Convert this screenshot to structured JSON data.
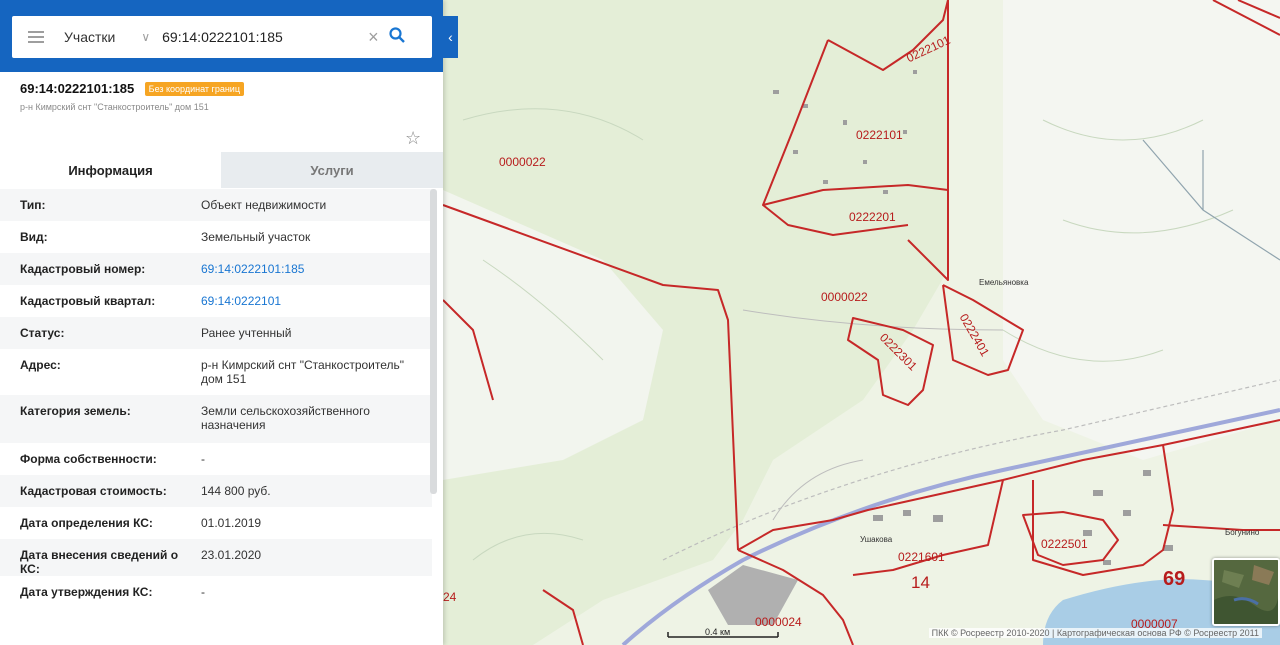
{
  "search": {
    "type_label": "Участки",
    "query": "69:14:0222101:185"
  },
  "object": {
    "number": "69:14:0222101:185",
    "badge": "Без координат границ",
    "address_short": "р-н Кимрский снт \"Станкостроитель\" дом 151"
  },
  "tabs": {
    "info": "Информация",
    "services": "Услуги"
  },
  "properties": [
    {
      "label": "Тип:",
      "value": "Объект недвижимости",
      "link": false
    },
    {
      "label": "Вид:",
      "value": "Земельный участок",
      "link": false
    },
    {
      "label": "Кадастровый номер:",
      "value": "69:14:0222101:185",
      "link": true
    },
    {
      "label": "Кадастровый квартал:",
      "value": "69:14:0222101",
      "link": true
    },
    {
      "label": "Статус:",
      "value": "Ранее учтенный",
      "link": false
    },
    {
      "label": "Адрес:",
      "value": "р-н Кимрский снт \"Станкостроитель\" дом 151",
      "link": false
    },
    {
      "label": "Категория земель:",
      "value": "Земли сельскохозяйственного назначения",
      "link": false
    },
    {
      "label": "Форма собственности:",
      "value": "-",
      "link": false
    },
    {
      "label": "Кадастровая стоимость:",
      "value": "144 800 руб.",
      "link": false
    },
    {
      "label": "Дата определения КС:",
      "value": "01.01.2019",
      "link": false
    },
    {
      "label": "Дата внесения сведений о КС:",
      "value": "23.01.2020",
      "link": false
    },
    {
      "label": "Дата утверждения КС:",
      "value": "-",
      "link": false
    }
  ],
  "map": {
    "labels": {
      "q0222101_a": "0222101",
      "q0222101_b": "0222101",
      "q0222201": "0222201",
      "q0000022_a": "0000022",
      "q0000022_b": "0000022",
      "q0222401": "0222401",
      "q0222301": "0222301",
      "q0221601": "0221601",
      "q0222501": "0222501",
      "q0000024": "0000024",
      "q0000007": "0000007",
      "edge24": "24",
      "district14": "14",
      "region69": "69"
    },
    "places": {
      "emelyanovka": "Емельяновка",
      "ushakovka": "Ушакова",
      "bogunino": "Богунино"
    },
    "scale": "0.4 км",
    "attribution": "ПКК © Росреестр 2010-2020 | Картографическая основа РФ © Росреестр 2011"
  },
  "colors": {
    "header": "#1565c0",
    "badge": "#f6a523",
    "boundary": "#c62828",
    "link": "#1976d2"
  }
}
